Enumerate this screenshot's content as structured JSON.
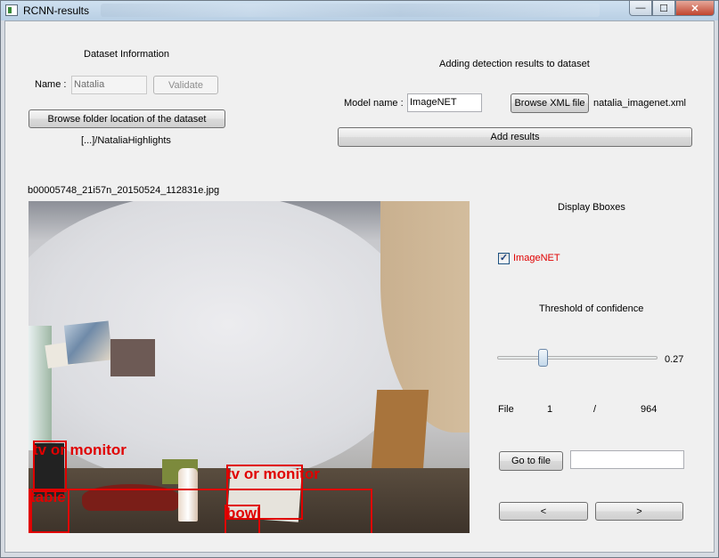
{
  "window": {
    "title": "RCNN-results",
    "controls": {
      "minimize": "—",
      "maximize": "☐",
      "close": "✕"
    }
  },
  "dataset": {
    "heading": "Dataset Information",
    "name_label": "Name :",
    "name_value": "Natalia",
    "validate_label": "Validate",
    "browse_label": "Browse folder location of the dataset",
    "folder_path": "[...]/NataliaHighlights"
  },
  "detection": {
    "heading": "Adding detection results to dataset",
    "model_label": "Model name :",
    "model_value": "ImageNET",
    "browse_xml_label": "Browse XML file",
    "xml_file": "natalia_imagenet.xml",
    "add_results_label": "Add results"
  },
  "image": {
    "filename": "b00005748_21i57n_20150524_112831e.jpg",
    "bboxes": [
      {
        "label": "tv or monitor"
      },
      {
        "label": "table"
      },
      {
        "label": "tv or monitor"
      },
      {
        "label": "bowl"
      }
    ]
  },
  "display": {
    "heading": "Display Bboxes",
    "model_checkbox_label": "ImageNET",
    "model_checked": true,
    "model_color": "#e00000"
  },
  "threshold": {
    "heading": "Threshold of confidence",
    "value_label": "0.27",
    "value": 0.27
  },
  "navigation": {
    "file_label": "File",
    "current": "1",
    "separator": "/",
    "total": "964",
    "goto_label": "Go to file",
    "goto_value": "",
    "prev_label": "<",
    "next_label": ">"
  }
}
